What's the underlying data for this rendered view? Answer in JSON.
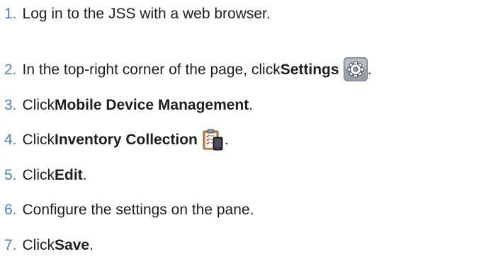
{
  "steps": [
    {
      "number": "1.",
      "text": "Log in to the JSS with a web browser."
    },
    {
      "number": "2.",
      "prefix": "In the top-right corner of the page, click ",
      "bold": "Settings",
      "icon": "gear-icon",
      "suffix": "."
    },
    {
      "number": "3.",
      "prefix": "Click ",
      "bold": "Mobile Device Management",
      "suffix": "."
    },
    {
      "number": "4.",
      "prefix": "Click ",
      "bold": "Inventory Collection",
      "icon": "clipboard-device-icon",
      "suffix": "."
    },
    {
      "number": "5.",
      "prefix": "Click ",
      "bold": "Edit",
      "suffix": "."
    },
    {
      "number": "6.",
      "text": "Configure the settings on the pane."
    },
    {
      "number": "7.",
      "prefix": "Click ",
      "bold": "Save",
      "suffix": "."
    }
  ],
  "colors": {
    "number": "#4a80c6",
    "text": "#1e1e1e"
  }
}
